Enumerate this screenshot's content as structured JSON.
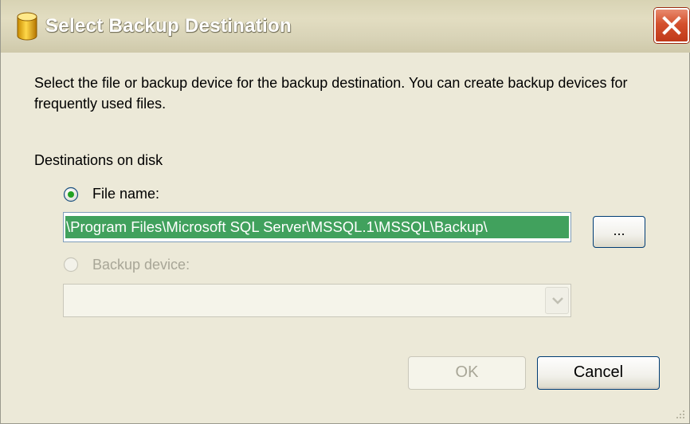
{
  "window": {
    "title": "Select Backup Destination"
  },
  "description": "Select the file or backup device for the backup destination. You can create backup devices for frequently used files.",
  "destinations": {
    "group_label": "Destinations on disk",
    "file_name_label": "File name:",
    "file_name_selected": true,
    "file_name_value": "\\Program Files\\Microsoft SQL Server\\MSSQL.1\\MSSQL\\Backup\\",
    "browse_label": "...",
    "backup_device_label": "Backup device:",
    "backup_device_selected": false,
    "backup_device_value": ""
  },
  "buttons": {
    "ok_label": "OK",
    "cancel_label": "Cancel"
  },
  "colors": {
    "selection": "#41a15d",
    "close_button": "#d4502d",
    "dialog_bg": "#ece9d8"
  },
  "icons": {
    "title": "database-icon",
    "close": "close-icon",
    "dropdown": "chevron-down-icon"
  }
}
